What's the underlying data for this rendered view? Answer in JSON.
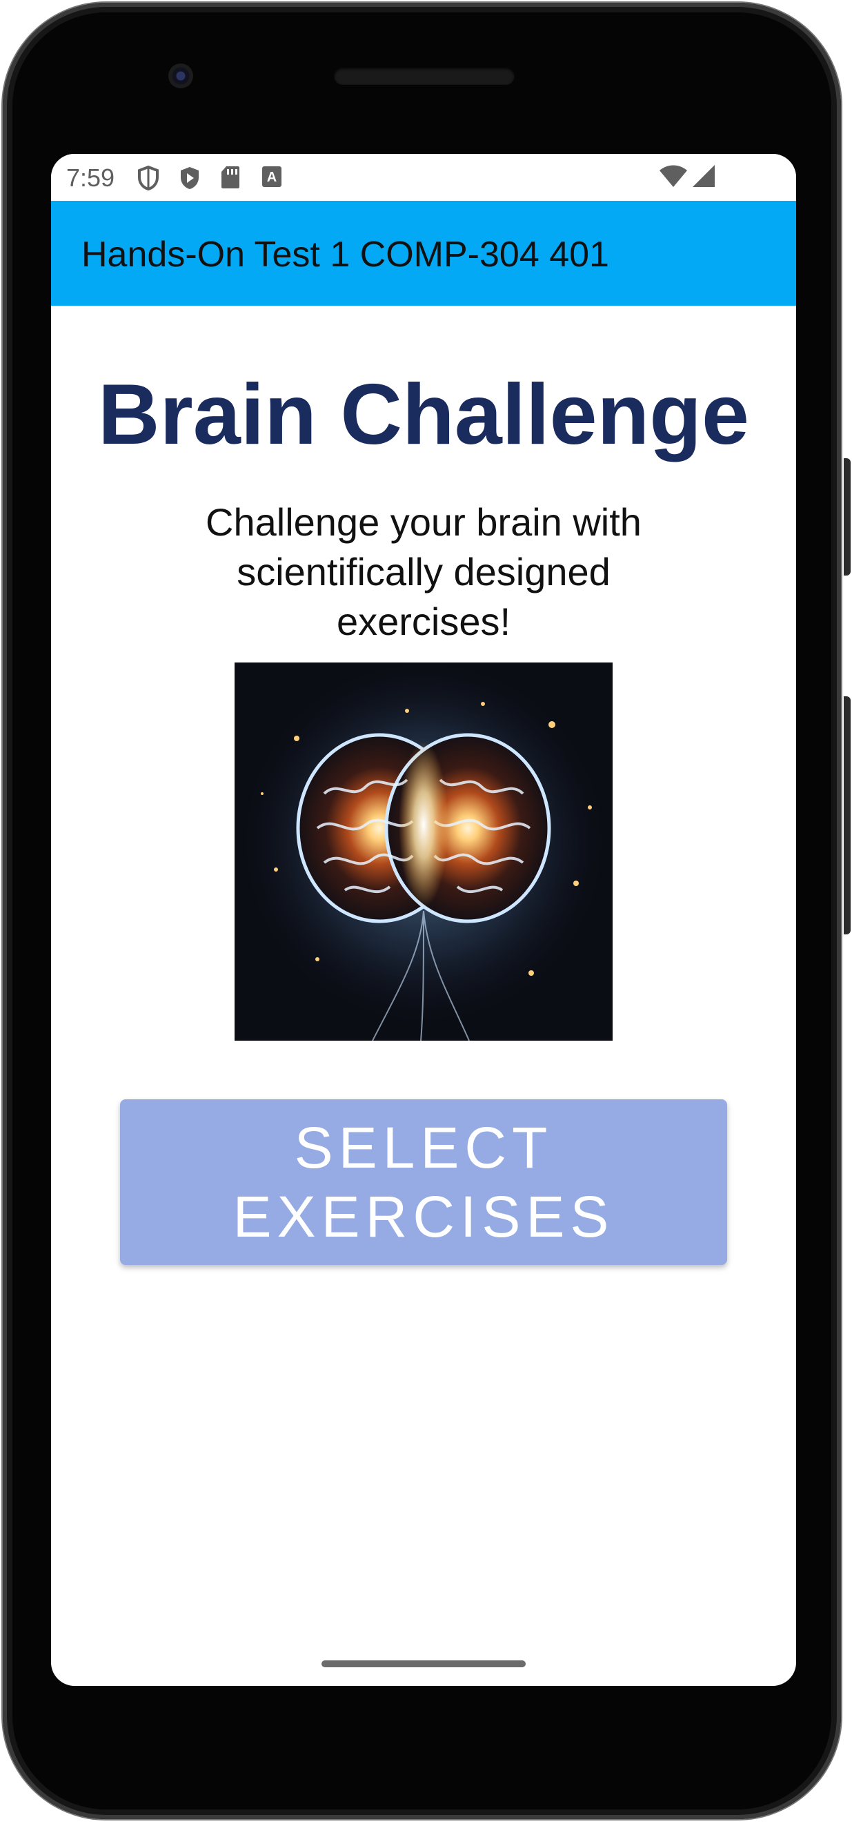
{
  "status_bar": {
    "time": "7:59",
    "icons": [
      "shield-outline-icon",
      "play-shield-icon",
      "sd-card-icon",
      "font-a-icon"
    ],
    "right_icons": [
      "wifi-icon",
      "cellular-signal-icon"
    ]
  },
  "app_bar": {
    "title": "Hands-On Test 1 COMP-304 401",
    "background": "#03a9f4"
  },
  "main": {
    "headline": "Brain Challenge",
    "subtitle": "Challenge your brain with scientifically designed exercises!",
    "image": "glowing-brain-image",
    "button_label": "SELECT EXERCISES"
  },
  "colors": {
    "headline": "#1a2b5e",
    "button": "#96abe3"
  }
}
